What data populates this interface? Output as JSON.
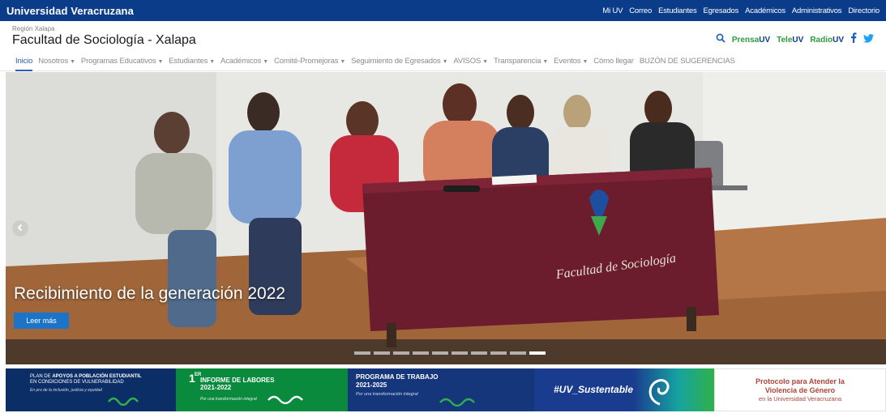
{
  "topbar": {
    "brand": "Universidad Veracruzana",
    "links": [
      "Mi UV",
      "Correo",
      "Estudiantes",
      "Egresados",
      "Académicos",
      "Administrativos",
      "Directorio"
    ]
  },
  "header": {
    "region": "Región Xalapa",
    "title": "Facultad de Sociología - Xalapa",
    "media": [
      {
        "pre": "Prensa",
        "uv": "UV"
      },
      {
        "pre": "Tele",
        "uv": "UV"
      },
      {
        "pre": "Radio",
        "uv": "UV"
      }
    ]
  },
  "nav": [
    {
      "label": "Inicio",
      "dropdown": false,
      "active": true
    },
    {
      "label": "Nosotros",
      "dropdown": true
    },
    {
      "label": "Programas Educativos",
      "dropdown": true
    },
    {
      "label": "Estudiantes",
      "dropdown": true
    },
    {
      "label": "Académicos",
      "dropdown": true
    },
    {
      "label": "Comité-Promejoras",
      "dropdown": true
    },
    {
      "label": "Seguimiento de Egresados",
      "dropdown": true
    },
    {
      "label": "AVISOS",
      "dropdown": true
    },
    {
      "label": "Transparencia",
      "dropdown": true
    },
    {
      "label": "Eventos",
      "dropdown": true
    },
    {
      "label": "Cómo llegar",
      "dropdown": false
    },
    {
      "label": "BUZÓN DE SUGERENCIAS",
      "dropdown": false
    }
  ],
  "hero": {
    "caption": "Recibimiento de la generación 2022",
    "button": "Leer más",
    "slides": 10,
    "active_slide": 10,
    "tablecloth_text": "Facultad de Sociología"
  },
  "banners": {
    "b1": {
      "line1_pre": "PLAN DE ",
      "line1_bold": "APOYOS A POBLACIÓN ESTUDIANTIL",
      "line2": "EN CONDICIONES DE VULNERABILIDAD",
      "line3": "En pro de la inclusión, justicia y equidad"
    },
    "b2": {
      "num": "1",
      "sup": "ER",
      "line1": "INFORME DE LABORES",
      "line2": "2021-2022",
      "line3": "Por una transformación integral"
    },
    "b3": {
      "line1": "PROGRAMA DE TRABAJO",
      "line2": "2021-2025",
      "line3": "Por una transformación integral"
    },
    "b4": {
      "hashtag": "#UV_Sustentable"
    },
    "b5": {
      "line1": "Protocolo para Atender la",
      "line2": "Violencia de Género",
      "line3": "en la Universidad Veracruzana"
    }
  },
  "colors": {
    "topbar": "#0b3c8a",
    "nav_active": "#2b5fb3",
    "button": "#1c74c8",
    "media_green": "#2d9b3b",
    "protocol_red": "#b0443a"
  }
}
